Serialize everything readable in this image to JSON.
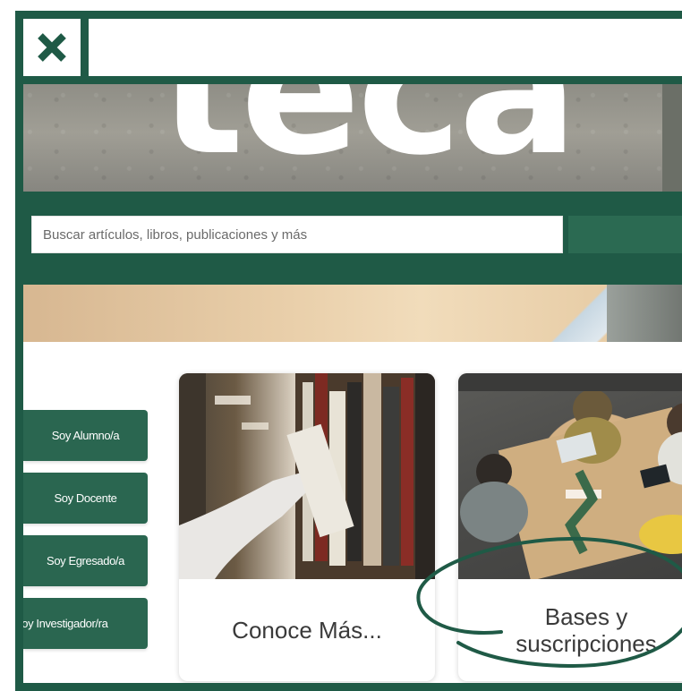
{
  "close_button": {
    "label": "✕"
  },
  "hero": {
    "word": "teca"
  },
  "search": {
    "placeholder": "Buscar artículos, libros, publicaciones y más"
  },
  "sidebar": {
    "buttons": [
      {
        "label": "Soy Alumno/a"
      },
      {
        "label": "Soy Docente"
      },
      {
        "label": "Soy Egresado/a"
      },
      {
        "label": "Soy Investigador/ra"
      }
    ]
  },
  "cards": [
    {
      "title": "Conoce Más..."
    },
    {
      "title": "Bases y suscripciones"
    }
  ],
  "colors": {
    "brand_green": "#1f5a46",
    "button_green": "#2a6650",
    "annotation_green": "#1f5a46"
  },
  "icons": {
    "close": "close-icon"
  }
}
